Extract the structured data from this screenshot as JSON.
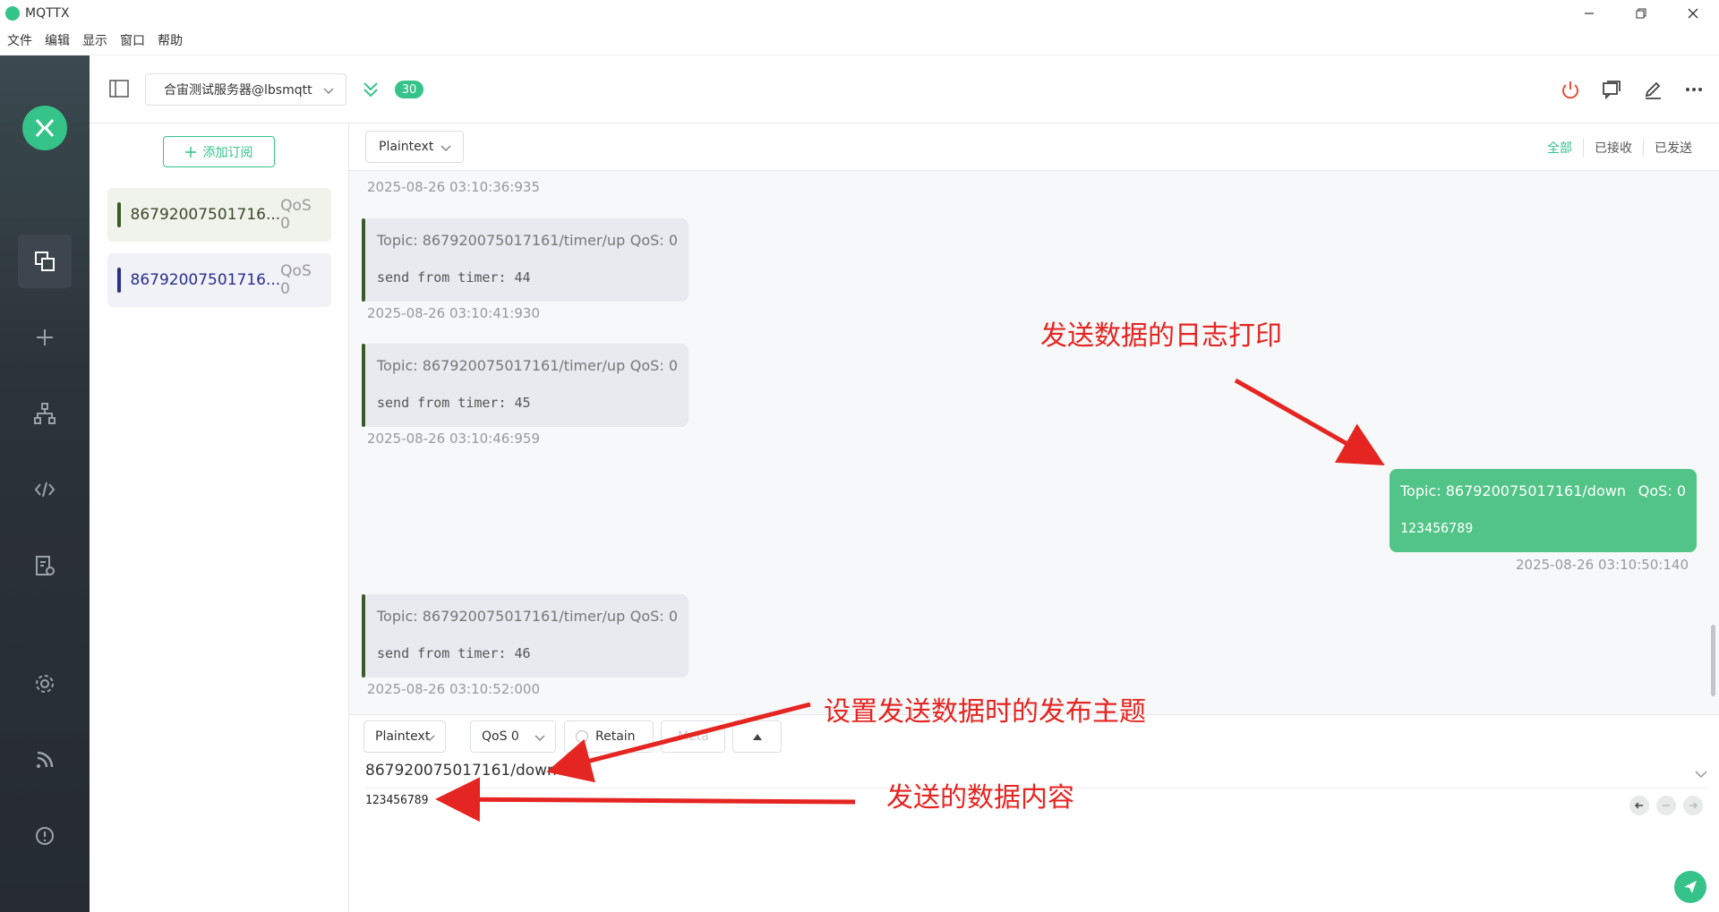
{
  "window": {
    "title": "MQTTX"
  },
  "menu": [
    "文件",
    "编辑",
    "显示",
    "窗口",
    "帮助"
  ],
  "connection": {
    "name": "合宙测试服务器@lbsmqtt",
    "badge_count": "30"
  },
  "subscriptions": {
    "add_label": "添加订阅",
    "items": [
      {
        "topic": "86792007501716...",
        "qos": "QoS 0",
        "color": "#3b5a2a"
      },
      {
        "topic": "86792007501716...",
        "qos": "QoS 0",
        "color": "#2a2f88"
      }
    ]
  },
  "messages": {
    "payload_format": "Plaintext",
    "filters": [
      "全部",
      "已接收",
      "已发送"
    ],
    "first_timestamp": "2025-08-26 03:10:36:935",
    "items": [
      {
        "topic": "Topic: 867920075017161/timer/up",
        "qos": "QoS: 0",
        "payload": "send from timer: 44",
        "time": "2025-08-26 03:10:41:930"
      },
      {
        "topic": "Topic: 867920075017161/timer/up",
        "qos": "QoS: 0",
        "payload": "send from timer: 45",
        "time": "2025-08-26 03:10:46:959"
      },
      {
        "topic": "Topic: 867920075017161/timer/up",
        "qos": "QoS: 0",
        "payload": "send from timer: 46",
        "time": "2025-08-26 03:10:52:000"
      }
    ],
    "sent": {
      "topic": "Topic: 867920075017161/down",
      "qos": "QoS: 0",
      "payload": "123456789",
      "time": "2025-08-26 03:10:50:140"
    }
  },
  "publish": {
    "format": "Plaintext",
    "qos": "QoS 0",
    "retain": "Retain",
    "meta": "Meta",
    "topic": "867920075017161/down",
    "payload": "123456789"
  },
  "annotations": {
    "log": "发送数据的日志打印",
    "topic": "设置发送数据时的发布主题",
    "content": "发送的数据内容"
  },
  "colors": {
    "accent": "#35c389",
    "annotation": "#e52521"
  }
}
